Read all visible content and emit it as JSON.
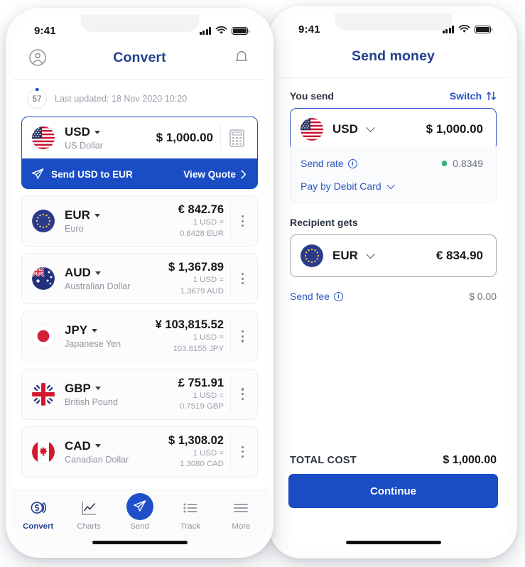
{
  "accent": {
    "blue": "#1a4cc4",
    "link": "#2a55c4",
    "title": "#22428f",
    "green": "#2fb573"
  },
  "convert_phone": {
    "status": {
      "time": "9:41",
      "signal_icon": "signal-bars-icon",
      "wifi_icon": "wifi-icon",
      "battery_icon": "battery-icon"
    },
    "header": {
      "title": "Convert",
      "profile_icon": "profile-icon",
      "bell_icon": "bell-icon"
    },
    "refresh": {
      "countdown": "57",
      "updated_text": "Last updated: 18 Nov 2020 10:20"
    },
    "primary": {
      "flag_icon": "flag-us-icon",
      "code": "USD",
      "name": "US Dollar",
      "amount": "$ 1,000.00",
      "calculator_icon": "calculator-icon"
    },
    "send_banner": {
      "send_icon": "paper-plane-icon",
      "label": "Send USD to EUR",
      "cta": "View Quote",
      "chevron_icon": "chevron-right-icon"
    },
    "currencies": [
      {
        "flag_icon": "flag-eu-icon",
        "code": "EUR",
        "name": "Euro",
        "amount": "€ 842.76",
        "rate_line1": "1 USD =",
        "rate_line2": "0.8428 EUR",
        "menu_icon": "kebab-menu-icon"
      },
      {
        "flag_icon": "flag-au-icon",
        "code": "AUD",
        "name": "Australian Dollar",
        "amount": "$ 1,367.89",
        "rate_line1": "1 USD =",
        "rate_line2": "1.3679 AUD",
        "menu_icon": "kebab-menu-icon"
      },
      {
        "flag_icon": "flag-jp-icon",
        "code": "JPY",
        "name": "Japanese Yen",
        "amount": "¥ 103,815.52",
        "rate_line1": "1 USD =",
        "rate_line2": "103.8155 JPY",
        "menu_icon": "kebab-menu-icon"
      },
      {
        "flag_icon": "flag-gb-icon",
        "code": "GBP",
        "name": "British Pound",
        "amount": "£ 751.91",
        "rate_line1": "1 USD =",
        "rate_line2": "0.7519 GBP",
        "menu_icon": "kebab-menu-icon"
      },
      {
        "flag_icon": "flag-ca-icon",
        "code": "CAD",
        "name": "Canadian Dollar",
        "amount": "$ 1,308.02",
        "rate_line1": "1 USD =",
        "rate_line2": "1.3080 CAD",
        "menu_icon": "kebab-menu-icon"
      }
    ],
    "tabs": [
      {
        "label": "Convert",
        "icon": "coins-icon",
        "active": true
      },
      {
        "label": "Charts",
        "icon": "line-chart-icon",
        "active": false
      },
      {
        "label": "Send",
        "icon": "paper-plane-icon",
        "active": false
      },
      {
        "label": "Track",
        "icon": "list-icon",
        "active": false
      },
      {
        "label": "More",
        "icon": "hamburger-icon",
        "active": false
      }
    ]
  },
  "send_phone": {
    "status": {
      "time": "9:41",
      "signal_icon": "signal-bars-icon",
      "wifi_icon": "wifi-icon",
      "battery_icon": "battery-icon"
    },
    "header": {
      "title": "Send money"
    },
    "you_send": {
      "label": "You send",
      "switch_label": "Switch",
      "switch_icon": "switch-arrows-icon",
      "flag_icon": "flag-us-icon",
      "code": "USD",
      "chevron_icon": "chevron-down-icon",
      "amount": "$ 1,000.00"
    },
    "rate": {
      "label": "Send rate",
      "info_icon": "info-icon",
      "status_dot": "green-dot-icon",
      "value": "0.8349",
      "payment_label": "Pay by Debit Card",
      "payment_chevron_icon": "chevron-down-icon"
    },
    "recipient": {
      "label": "Recipient gets",
      "flag_icon": "flag-eu-icon",
      "code": "EUR",
      "chevron_icon": "chevron-down-icon",
      "amount": "€ 834.90"
    },
    "fee": {
      "label": "Send fee",
      "info_icon": "info-icon",
      "value": "$ 0.00"
    },
    "total": {
      "label": "TOTAL COST",
      "value": "$ 1,000.00"
    },
    "continue_label": "Continue"
  }
}
